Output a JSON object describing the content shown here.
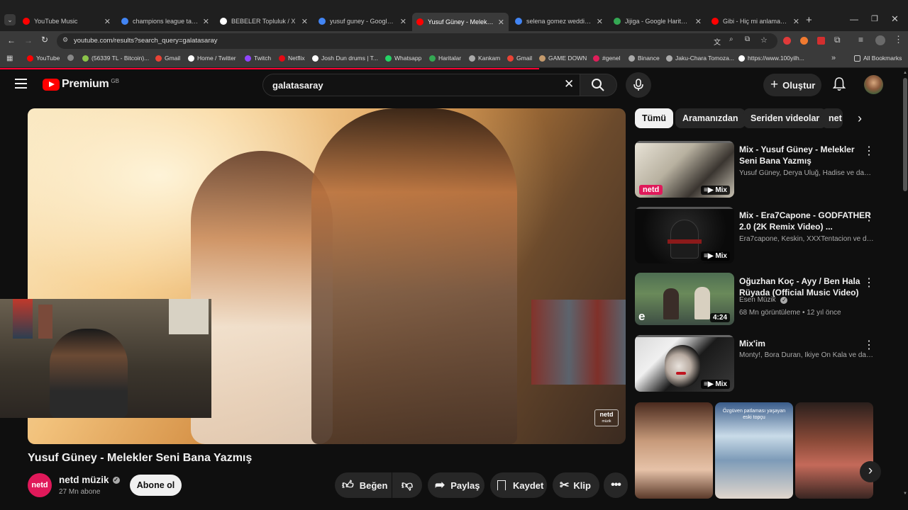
{
  "browser": {
    "tabs": [
      {
        "label": "YouTube Music",
        "color": "#ff0000"
      },
      {
        "label": "champions league table\\",
        "color": "#4285f4"
      },
      {
        "label": "BEBELER Topluluk / X",
        "color": "#ffffff"
      },
      {
        "label": "yusuf guney - Google'da ...",
        "color": "#4285f4"
      },
      {
        "label": "Yusuf Güney - Melekler S...",
        "color": "#ff0000"
      },
      {
        "label": "selena gomez wedding - ...",
        "color": "#4285f4"
      },
      {
        "label": "Jijiga - Google Haritalar",
        "color": "#34a853"
      },
      {
        "label": "Gibi - Hiç mi anlamadın ö...",
        "color": "#ff0000"
      }
    ],
    "url": "youtube.com/results?search_query=galatasaray",
    "bookmarks": [
      {
        "label": "YouTube",
        "color": "#ff0000"
      },
      {
        "label": "",
        "color": "#888888"
      },
      {
        "label": "(56339 TL - Bitcoin)...",
        "color": "#8bc34a"
      },
      {
        "label": "Gmail",
        "color": "#ea4335"
      },
      {
        "label": "Home / Twitter",
        "color": "#ffffff"
      },
      {
        "label": "Twitch",
        "color": "#9146ff"
      },
      {
        "label": "Netflix",
        "color": "#e50914"
      },
      {
        "label": "Josh Dun drums | T...",
        "color": "#ffffff"
      },
      {
        "label": "Whatsapp",
        "color": "#25d366"
      },
      {
        "label": "Haritalar",
        "color": "#34a853"
      },
      {
        "label": "Kankam",
        "color": "#aaaaaa"
      },
      {
        "label": "Gmail",
        "color": "#ea4335"
      },
      {
        "label": "GAME DOWN",
        "color": "#c49a6c"
      },
      {
        "label": "#genel",
        "color": "#e01e5a"
      },
      {
        "label": "Binance",
        "color": "#aaaaaa"
      },
      {
        "label": "Jaku-Chara Tomoza...",
        "color": "#aaaaaa"
      },
      {
        "label": "https://www.100yilh...",
        "color": "#ffffff"
      }
    ],
    "all_bookmarks": "All Bookmarks"
  },
  "youtube": {
    "logo": "Premium",
    "region": "GB",
    "search_value": "galatasaray",
    "create_label": "Oluştur"
  },
  "video": {
    "title": "Yusuf Güney - Melekler Seni Bana Yazmış",
    "channel": "netd müzik",
    "channel_logo": "netd",
    "subscribers": "27 Mn abone",
    "subscribe_label": "Abone ol",
    "like_label": "Beğen",
    "share_label": "Paylaş",
    "save_label": "Kaydet",
    "clip_label": "Klip",
    "watermark_top": "netd",
    "watermark_bottom": "müzik"
  },
  "sidebar": {
    "chips": [
      "Tümü",
      "Aramanızdan",
      "Seriden videolar",
      "net"
    ],
    "items": [
      {
        "title": "Mix - Yusuf Güney - Melekler Seni Bana Yazmış",
        "meta1": "Yusuf Güney, Derya Uluğ, Hadise ve daha...",
        "meta2": "",
        "badge": "Mix",
        "overlay": "netd"
      },
      {
        "title": "Mix - Era7Capone - GODFATHER 2.0 (2K Remix Video) ...",
        "meta1": "Era7capone, Keskin, XXXTentacion ve da...",
        "meta2": "",
        "badge": "Mix",
        "overlay": ""
      },
      {
        "title": "Oğuzhan Koç - Ayy / Ben Hala Rüyada  (Official Music Video)",
        "meta1": "Esen Müzik",
        "meta2": "68 Mn görüntüleme • 12 yıl önce",
        "badge": "4:24",
        "overlay": "e"
      },
      {
        "title": "Mix'im",
        "meta1": "Monty!, Bora Duran, İkiye On Kala ve dah...",
        "meta2": "",
        "badge": "Mix",
        "overlay": ""
      }
    ],
    "shorts_caption": "Özgüven patlaması yaşayan eski topçu"
  }
}
